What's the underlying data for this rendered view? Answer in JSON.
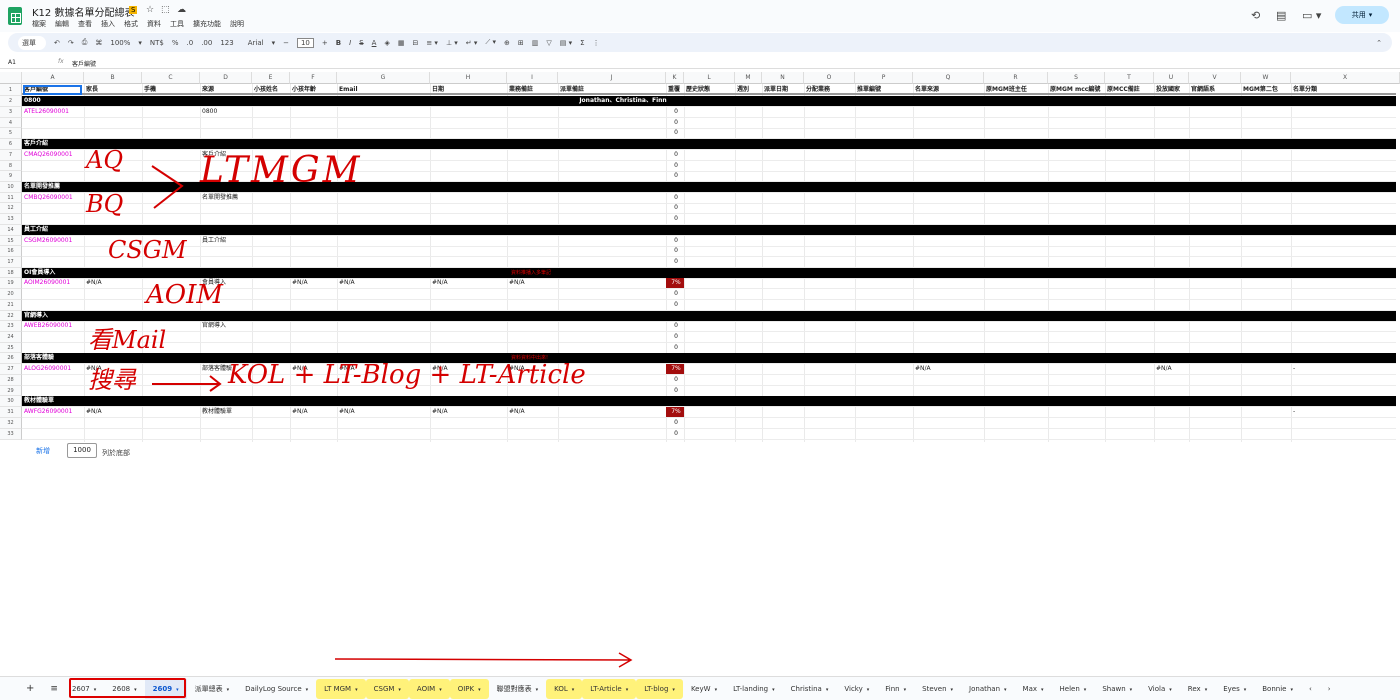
{
  "doc": {
    "title": "K12 數據名單分配總表",
    "badge": "S",
    "star": "☆",
    "move": "⬚",
    "cloud": "☁"
  },
  "menus": [
    "檔案",
    "編輯",
    "查看",
    "插入",
    "格式",
    "資料",
    "工具",
    "擴充功能",
    "說明"
  ],
  "header_right": {
    "history": "⟲",
    "comment": "▤",
    "meet": "▭ ▾",
    "share": "共用",
    "share_arrow": "▾"
  },
  "toolbar": {
    "search": "選單",
    "undo": "↶",
    "redo": "↷",
    "print": "⎙",
    "paint": "⌘",
    "zoom": "100%",
    "zoom_caret": "▾",
    "currency": "NT$",
    "percent": "%",
    "dec_less": ".0",
    "dec_more": ".00",
    "fmt123": "123",
    "font": "Arial",
    "font_caret": "▾",
    "minus": "−",
    "font_size": "10",
    "plus": "+",
    "bold": "B",
    "italic": "I",
    "strike": "S",
    "text_color": "A",
    "fill": "◈",
    "borders": "▦",
    "merge": "⊟",
    "align": "≡ ▾",
    "valign": "⊥ ▾",
    "wrap": "↵ ▾",
    "rotate": "⟋ ▾",
    "link": "⊕",
    "add_comment": "⊞",
    "chart": "▥",
    "filter": "▽",
    "filter_views": "▤ ▾",
    "functions": "Σ",
    "more": "⋮",
    "collapse": "⌃"
  },
  "formula": {
    "cell": "A1",
    "fx": "fx",
    "value": "客戶編號"
  },
  "columns": [
    "A",
    "B",
    "C",
    "D",
    "E",
    "F",
    "G",
    "H",
    "I",
    "J",
    "K",
    "L",
    "M",
    "N",
    "O",
    "P",
    "Q",
    "R",
    "S",
    "T",
    "U",
    "V",
    "W",
    "X"
  ],
  "headers": [
    "客戶編號",
    "家長",
    "手機",
    "來源",
    "小孩姓名",
    "小孩年齡",
    "Email",
    "日期",
    "業務備註",
    "派單備註",
    "重覆",
    "歷史狀態",
    "週別",
    "派單日期",
    "分配業務",
    "推單編號",
    "名單來源",
    "原MGM班主任",
    "原MGM mcc編號",
    "原MCC備註",
    "投放國家",
    "官網語系",
    "MGM第二包",
    "名單分類"
  ],
  "row_numbers": [
    "1",
    "2",
    "3",
    "4",
    "5",
    "6",
    "7",
    "8",
    "9",
    "10",
    "11",
    "12",
    "13",
    "14",
    "15",
    "16",
    "17",
    "18",
    "19",
    "20",
    "21",
    "22",
    "23",
    "24",
    "25",
    "26",
    "27",
    "28",
    "29",
    "30",
    "31",
    "32",
    "33"
  ],
  "zero": "0",
  "na": "#N/A",
  "pct": "7%",
  "dash": "-",
  "sections": [
    {
      "label": "0800",
      "id": "ATEL26090001",
      "source": "0800",
      "extra": "Jonathan、Christina、Finn"
    },
    {
      "label": "客戶介紹",
      "id": "CMAQ26090001",
      "source": "客戶介紹"
    },
    {
      "label": "名單開發推薦",
      "id": "CMBQ26090001",
      "source": "名單開發推薦"
    },
    {
      "label": "員工介紹",
      "id": "CSGM26090001",
      "source": "員工介紹"
    },
    {
      "label": "OI會員導入",
      "id": "AOIM26090001",
      "source": "會員導入",
      "error": "資料推播入多筆記"
    },
    {
      "label": "官網導入",
      "id": "AWEB26090001",
      "source": "官網導入"
    },
    {
      "label": "部落客體驗",
      "id": "ALOG26090001",
      "source": "部落客體驗",
      "error": "資料資料中出來!"
    },
    {
      "label": "教材體驗單",
      "id": "AWFG26090001",
      "source": "教材體驗單"
    }
  ],
  "bottom": {
    "add": "新增",
    "rows": "1000",
    "rows_label": "列於底部"
  },
  "annotations": {
    "aq": "AQ",
    "bq": "BQ",
    "ltmgm": "LTMGM",
    "csgm": "CSGM",
    "aoim": "AOIM",
    "mail": "看Mail",
    "search": "搜尋",
    "kol": "KOL + LT-Blog + LT-Article"
  },
  "tabs": {
    "add": "+",
    "all": "≡",
    "items": [
      {
        "label": "2607",
        "caret": "▾"
      },
      {
        "label": "2608",
        "caret": "▾"
      },
      {
        "label": "2609",
        "caret": "▾"
      },
      {
        "label": "派單總表",
        "caret": "▾"
      },
      {
        "label": "DailyLog Source",
        "caret": "▾"
      },
      {
        "label": "LT MGM",
        "caret": "▾"
      },
      {
        "label": "CSGM",
        "caret": "▾"
      },
      {
        "label": "AOIM",
        "caret": "▾"
      },
      {
        "label": "OIPK",
        "caret": "▾"
      },
      {
        "label": "聯盟對應表",
        "caret": "▾"
      },
      {
        "label": "KOL",
        "caret": "▾"
      },
      {
        "label": "LT-Article",
        "caret": "▾"
      },
      {
        "label": "LT-blog",
        "caret": "▾"
      },
      {
        "label": "KeyW",
        "caret": "▾"
      },
      {
        "label": "LT-landing",
        "caret": "▾"
      },
      {
        "label": "Christina",
        "caret": "▾"
      },
      {
        "label": "Vicky",
        "caret": "▾"
      },
      {
        "label": "Finn",
        "caret": "▾"
      },
      {
        "label": "Steven",
        "caret": "▾"
      },
      {
        "label": "Jonathan",
        "caret": "▾"
      },
      {
        "label": "Max",
        "caret": "▾"
      },
      {
        "label": "Helen",
        "caret": "▾"
      },
      {
        "label": "Shawn",
        "caret": "▾"
      },
      {
        "label": "Viola",
        "caret": "▾"
      },
      {
        "label": "Rex",
        "caret": "▾"
      },
      {
        "label": "Eyes",
        "caret": "▾"
      },
      {
        "label": "Bonnie",
        "caret": "▾"
      }
    ],
    "prev": "‹",
    "next": "›"
  },
  "colors": {
    "accent": "#1a73e8",
    "section": "#000000",
    "error_fill": "#a30d0d",
    "highlight": "#fff27a",
    "ink": "#d40000"
  }
}
